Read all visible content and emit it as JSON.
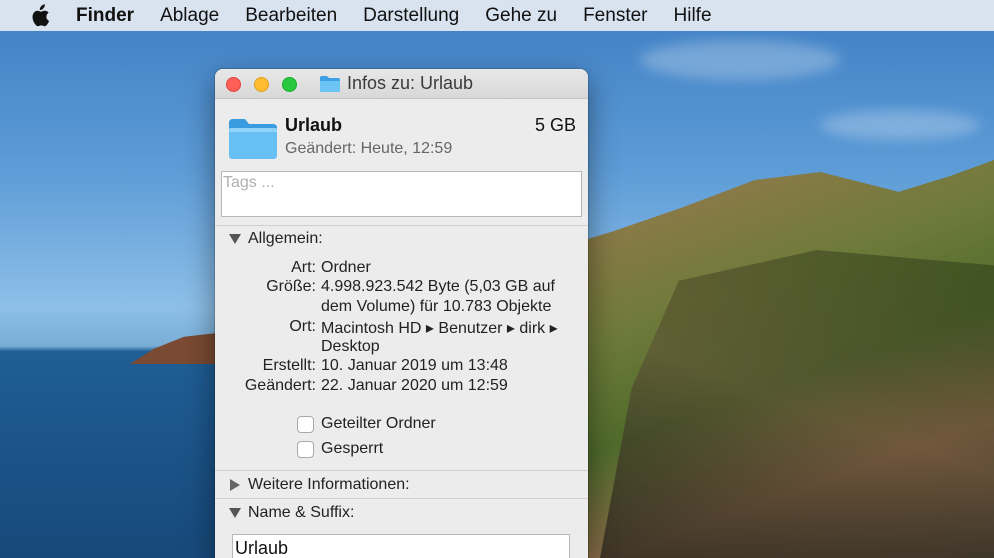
{
  "menubar": {
    "apple_icon": "apple-icon",
    "items": [
      "Finder",
      "Ablage",
      "Bearbeiten",
      "Darstellung",
      "Gehe zu",
      "Fenster",
      "Hilfe"
    ]
  },
  "window": {
    "title": "Infos zu: Urlaub",
    "folder_icon": "folder-icon",
    "name": "Urlaub",
    "size": "5 GB",
    "modified": "Geändert: Heute, 12:59",
    "tags_placeholder": "Tags ...",
    "general": {
      "heading": "Allgemein:",
      "rows": [
        {
          "label": "Art:",
          "value": "Ordner"
        },
        {
          "label": "Größe:",
          "value": "4.998.923.542 Byte (5,03 GB auf"
        },
        {
          "label": "",
          "value": "dem Volume) für 10.783 Objekte"
        },
        {
          "label": "Ort:",
          "value": "Macintosh HD ▸ Benutzer ▸ dirk ▸"
        },
        {
          "label": "",
          "value": "Desktop"
        },
        {
          "label": "Erstellt:",
          "value": "10. Januar 2019 um 13:48"
        },
        {
          "label": "Geändert:",
          "value": "22. Januar 2020 um 12:59"
        }
      ],
      "shared_folder_label": "Geteilter Ordner",
      "locked_label": "Gesperrt"
    },
    "more_info_heading": "Weitere Informationen:",
    "name_suffix_heading": "Name & Suffix:",
    "name_field_value": "Urlaub"
  },
  "colors": {
    "close": "#fe5f57",
    "minimize": "#febc2e",
    "maximize": "#28c840",
    "folder": "#5ab6f0"
  }
}
